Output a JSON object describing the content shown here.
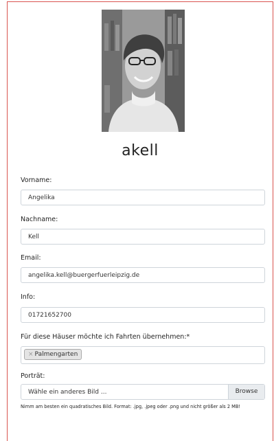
{
  "profile": {
    "username": "akell"
  },
  "form": {
    "firstname": {
      "label": "Vorname:",
      "value": "Angelika"
    },
    "lastname": {
      "label": "Nachname:",
      "value": "Kell"
    },
    "email": {
      "label": "Email:",
      "value": "angelika.kell@buergerfuerleipzig.de"
    },
    "info": {
      "label": "Info:",
      "value": "01721652700"
    },
    "houses": {
      "label": "Für diese Häuser möchte ich Fahrten übernehmen:*",
      "tag_remove": "×",
      "tags": [
        "Palmengarten"
      ]
    },
    "portrait": {
      "label": "Porträt:",
      "placeholder": "Wähle ein anderes Bild ...",
      "browse": "Browse",
      "help": "Nimm am besten ein quadratisches Bild. Format: .jpg, .jpeg oder .png und nicht größer als 2 MB!"
    }
  },
  "colors": {
    "card_border": "#d9534f",
    "input_border": "#ced4da"
  }
}
